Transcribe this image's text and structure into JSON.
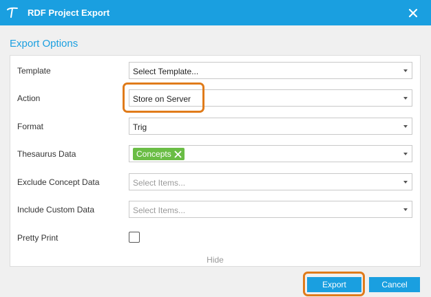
{
  "window": {
    "title": "RDF Project Export",
    "logo_icon": "app-logo-icon",
    "close_icon": "close-icon",
    "titlebar_color": "#1a9fe0"
  },
  "section_title": "Export Options",
  "fields": {
    "template": {
      "label": "Template",
      "value": "Select Template..."
    },
    "action": {
      "label": "Action",
      "value": "Store on Server"
    },
    "format": {
      "label": "Format",
      "value": "Trig"
    },
    "thesaurus": {
      "label": "Thesaurus Data",
      "tags": [
        "Concepts"
      ]
    },
    "exclude": {
      "label": "Exclude Concept Data",
      "placeholder": "Select Items..."
    },
    "include": {
      "label": "Include Custom Data",
      "placeholder": "Select Items..."
    },
    "pretty_print": {
      "label": "Pretty Print",
      "checked": false
    }
  },
  "hide_label": "Hide",
  "buttons": {
    "export": "Export",
    "cancel": "Cancel"
  },
  "colors": {
    "accent": "#1a9fe0",
    "tag": "#6abd45",
    "highlight": "#e07b1a"
  }
}
